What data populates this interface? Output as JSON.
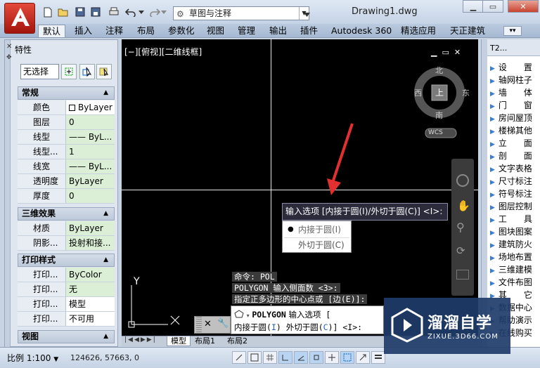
{
  "app": {
    "document_title": "Drawing1.dwg",
    "workspace": "草图与注释"
  },
  "ribbon_tabs": [
    "默认",
    "插入",
    "注释",
    "布局",
    "参数化",
    "视图",
    "管理",
    "输出",
    "插件",
    "Autodesk 360",
    "精选应用",
    "天正建筑"
  ],
  "properties": {
    "title": "特性",
    "selection": "无选择",
    "sections": [
      {
        "name": "常规",
        "rows": [
          [
            "颜色",
            "ByLayer"
          ],
          [
            "图层",
            "0"
          ],
          [
            "线型",
            "—— ByL..."
          ],
          [
            "线型...",
            "1"
          ],
          [
            "线宽",
            "—— ByL..."
          ],
          [
            "透明度",
            "ByLayer"
          ],
          [
            "厚度",
            "0"
          ]
        ]
      },
      {
        "name": "三维效果",
        "rows": [
          [
            "材质",
            "ByLayer"
          ],
          [
            "阴影...",
            "投射和接..."
          ]
        ]
      },
      {
        "name": "打印样式",
        "rows": [
          [
            "打印...",
            "ByColor"
          ],
          [
            "打印...",
            "无"
          ],
          [
            "打印...",
            "模型"
          ],
          [
            "打印...",
            "不可用"
          ]
        ]
      },
      {
        "name": "视图",
        "rows": []
      }
    ]
  },
  "viewport": {
    "label": "[−][俯视][二维线框]",
    "ucs_y": "Y"
  },
  "viewcube": {
    "north": "北",
    "south": "南",
    "east": "东",
    "west": "西",
    "top": "上",
    "wcs": "WCS"
  },
  "dynamic_prompt": {
    "text": "输入选项 [内接于圆(I)/外切于圆(C)] <I>:",
    "options": [
      "内接于圆(I)",
      "外切于圆(C)"
    ],
    "selected": 0
  },
  "command_history": [
    "命令: POL",
    "POLYGON 输入侧面数 <3>:",
    "指定正多边形的中心点或 [边(E)]:"
  ],
  "command_line": {
    "command": "POLYGON",
    "prompt": "输入选项 [",
    "line2_a": "内接于圆(",
    "opt_i": "I",
    "line2_b": ") 外切于圆(",
    "opt_c": "C",
    "line2_c": ")] <I>:"
  },
  "layout_tabs": [
    "模型",
    "布局1",
    "布局2"
  ],
  "tool_palette": {
    "title": "T2...",
    "items": [
      "设　　置",
      "轴网柱子",
      "墙　　体",
      "门　　窗",
      "房间屋顶",
      "楼梯其他",
      "立　　面",
      "剖　　面",
      "文字表格",
      "尺寸标注",
      "符号标注",
      "图层控制",
      "工　　具",
      "图块图案",
      "建筑防火",
      "场地布置",
      "三维建模",
      "文件布图",
      "其　　它",
      "数据中心",
      "帮助演示",
      "在线购买"
    ]
  },
  "status": {
    "scale": "比例 1:100",
    "coords": "124626, 57663, 0"
  },
  "watermark": {
    "brand": "溜溜自学",
    "url": "ZIXUE.3D66.COM"
  }
}
